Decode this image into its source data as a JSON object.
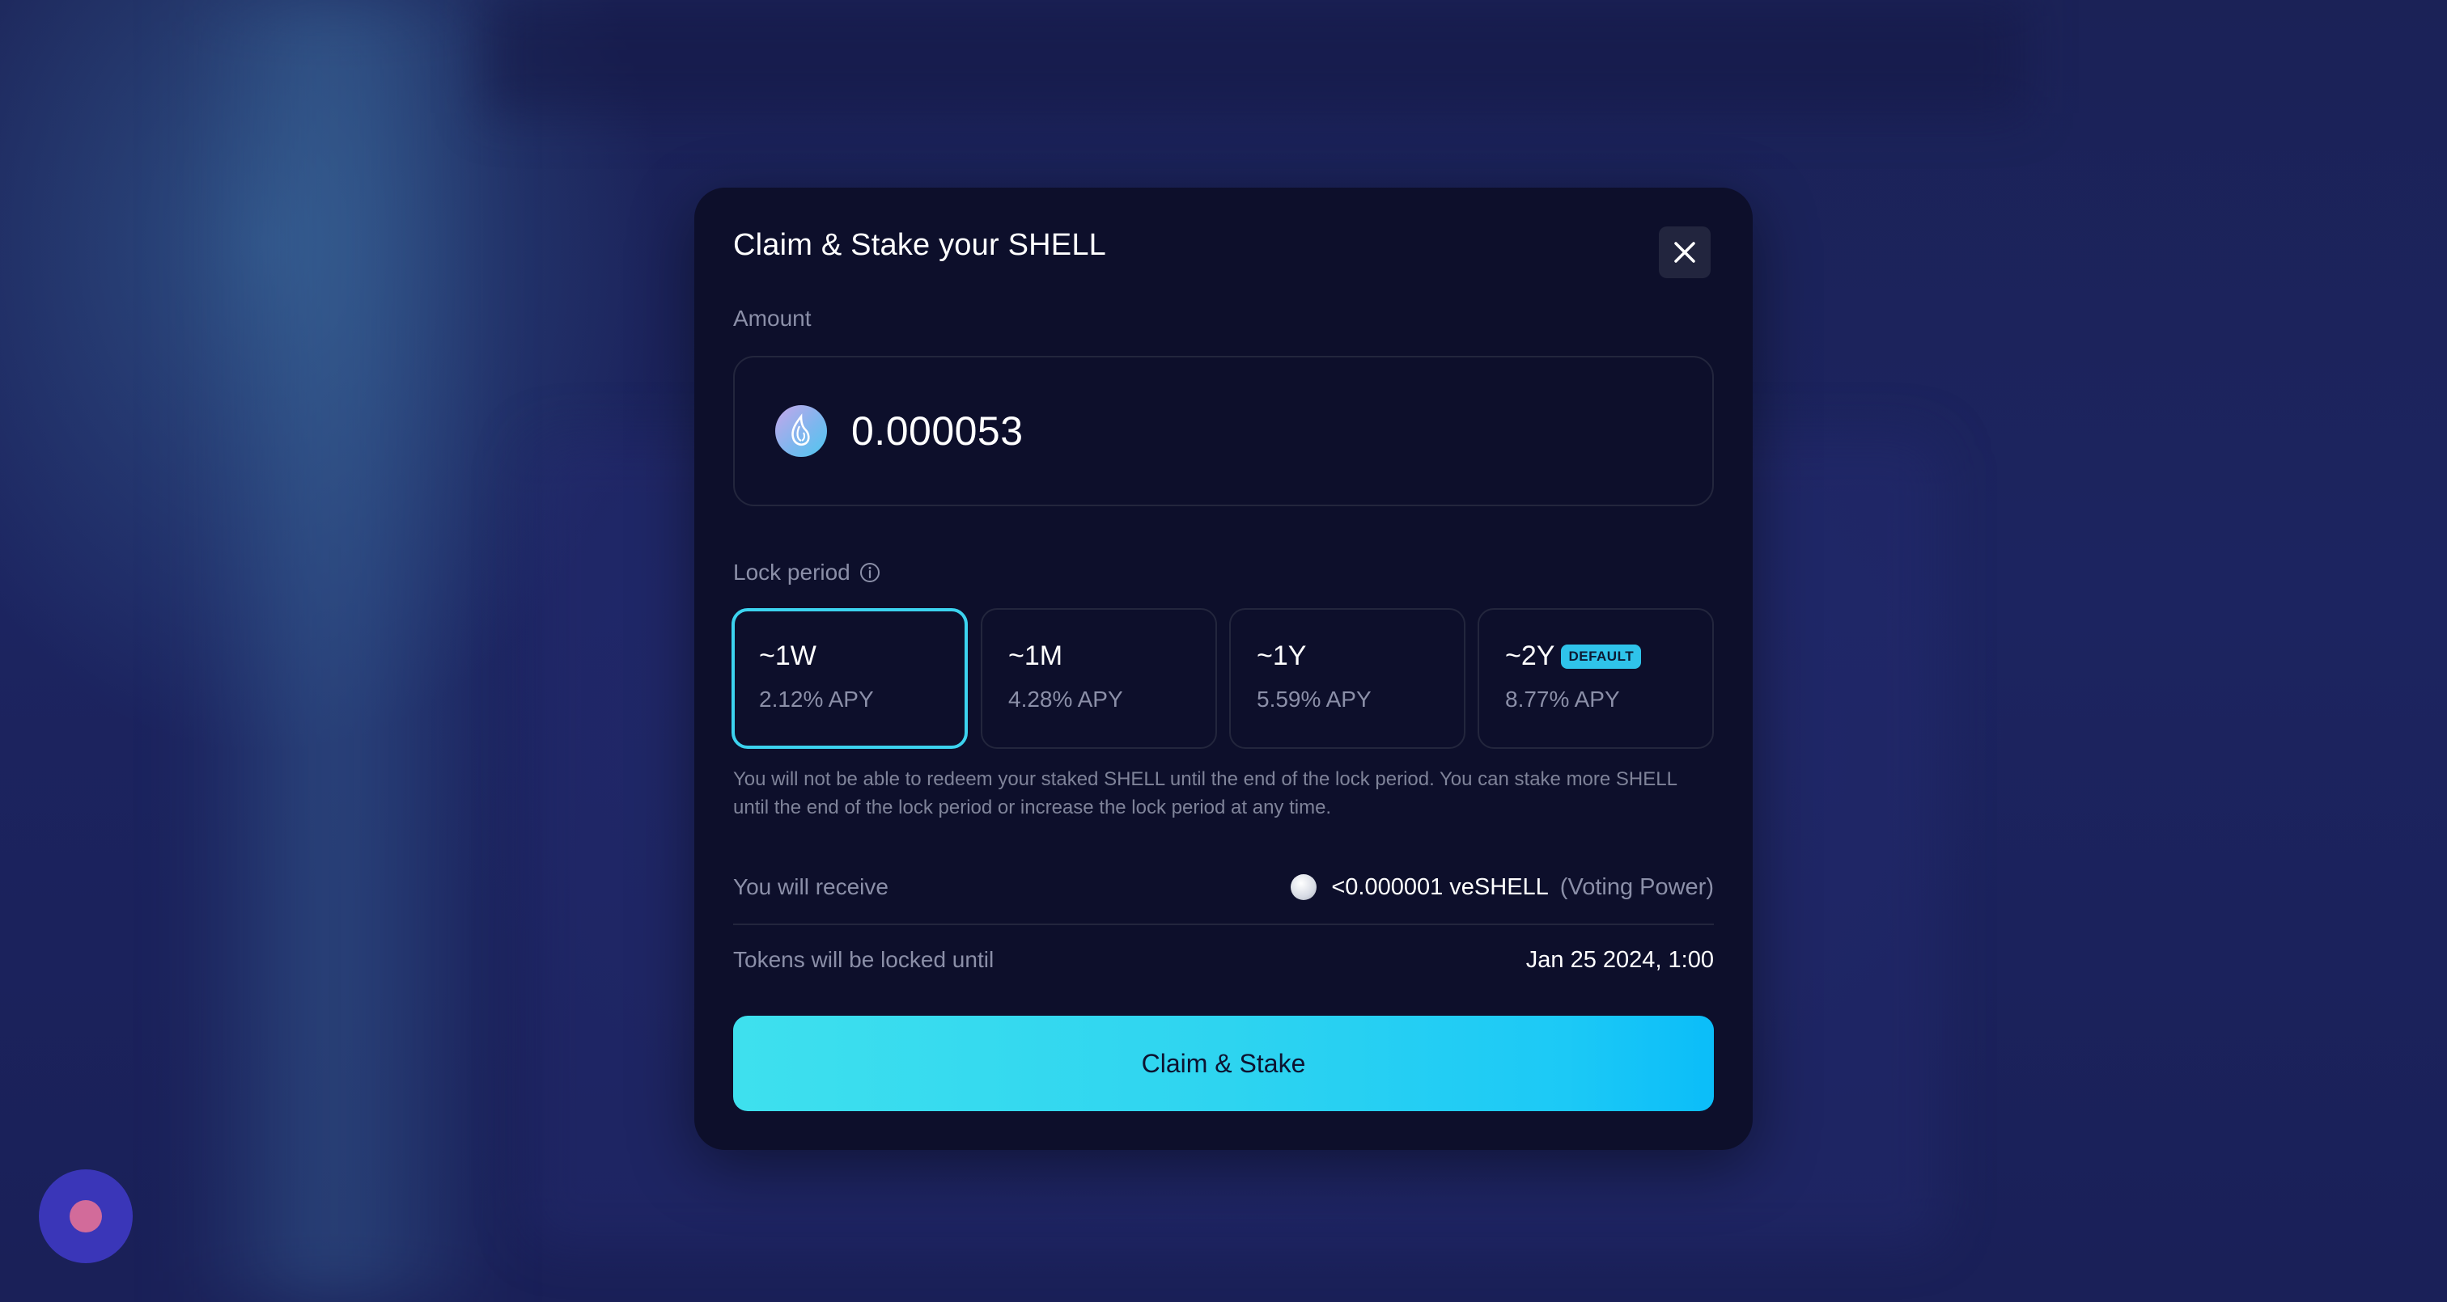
{
  "modal": {
    "title": "Claim & Stake your SHELL",
    "amount_label": "Amount",
    "amount_value": "0.000053",
    "token_icon": "shell-token-icon",
    "lock_label": "Lock period",
    "periods": [
      {
        "name": "~1W",
        "apy": "2.12% APY",
        "selected": true
      },
      {
        "name": "~1M",
        "apy": "4.28% APY",
        "selected": false
      },
      {
        "name": "~1Y",
        "apy": "5.59% APY",
        "selected": false
      },
      {
        "name": "~2Y",
        "apy": "8.77% APY",
        "badge": "DEFAULT",
        "selected": false
      }
    ],
    "notice": "You will not be able to redeem your staked SHELL until the end of the lock period. You can stake more SHELL until the end of the lock period or increase the lock period at any time.",
    "receive_label": "You will receive",
    "receive_value": "<0.000001 veSHELL",
    "receive_suffix": "(Voting Power)",
    "locked_label": "Tokens will be locked until",
    "locked_value": "Jan 25 2024, 1:00",
    "cta_label": "Claim & Stake"
  },
  "colors": {
    "accent": "#3cd3ef",
    "modal_bg": "#0d0f2b",
    "page_bg": "#1a1f52"
  }
}
